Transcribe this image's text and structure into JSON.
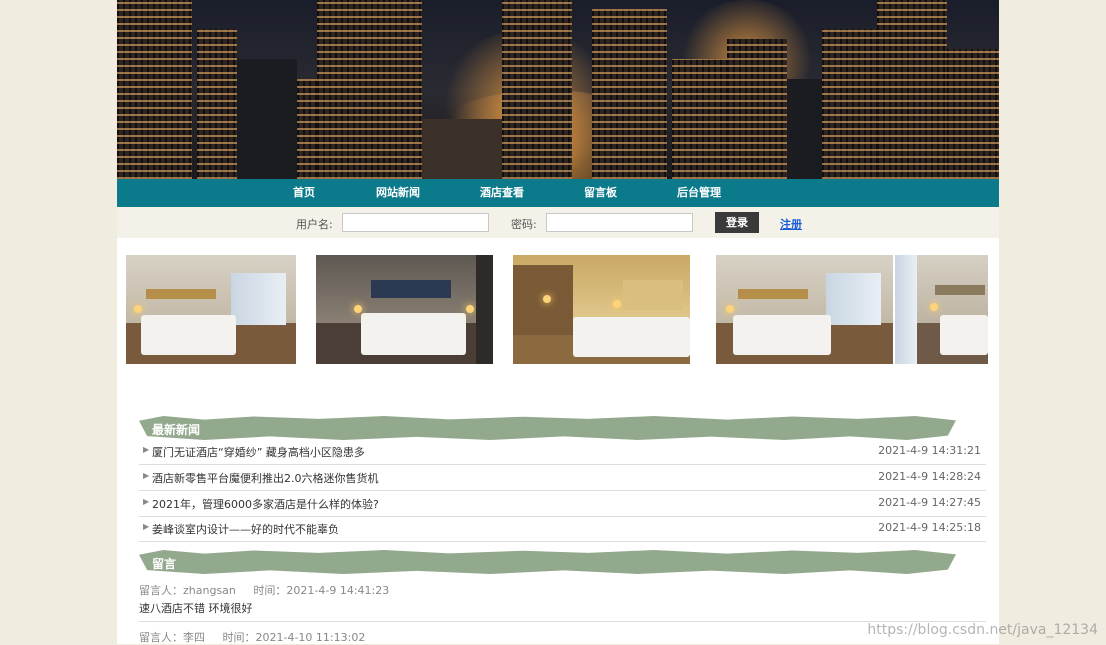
{
  "nav": {
    "items": [
      {
        "label": "首页"
      },
      {
        "label": "网站新闻"
      },
      {
        "label": "酒店查看"
      },
      {
        "label": "留言板"
      },
      {
        "label": "后台管理"
      }
    ]
  },
  "login": {
    "username_label": "用户名:",
    "username_value": "",
    "password_label": "密码:",
    "password_value": "",
    "login_button": "登录",
    "register_link": "注册"
  },
  "gallery": {
    "icon": "hotel-room-photo"
  },
  "news": {
    "title": "最新新闻",
    "items": [
      {
        "title": "厦门无证酒店“穿婚纱” 藏身高档小区隐患多",
        "date": "2021-4-9 14:31:21"
      },
      {
        "title": "酒店新零售平台魔便利推出2.0六格迷你售货机",
        "date": "2021-4-9 14:28:24"
      },
      {
        "title": "2021年，管理6000多家酒店是什么样的体验?",
        "date": "2021-4-9 14:27:45"
      },
      {
        "title": "姜峰谈室内设计——好的时代不能辜负",
        "date": "2021-4-9 14:25:18"
      }
    ]
  },
  "messages": {
    "title": "留言",
    "items": [
      {
        "author": "留言人：zhangsan",
        "time": "时间：2021-4-9 14:41:23",
        "content": "速八酒店不错 环境很好"
      },
      {
        "author": "留言人：李四",
        "time": "时间：2021-4-10 11:13:02",
        "content": ""
      }
    ]
  },
  "watermark": "https://blog.csdn.net/java_12134",
  "colors": {
    "nav_bg": "#0b7a8a",
    "section_header": "#93a98e",
    "register_link": "#1a5fd6"
  }
}
